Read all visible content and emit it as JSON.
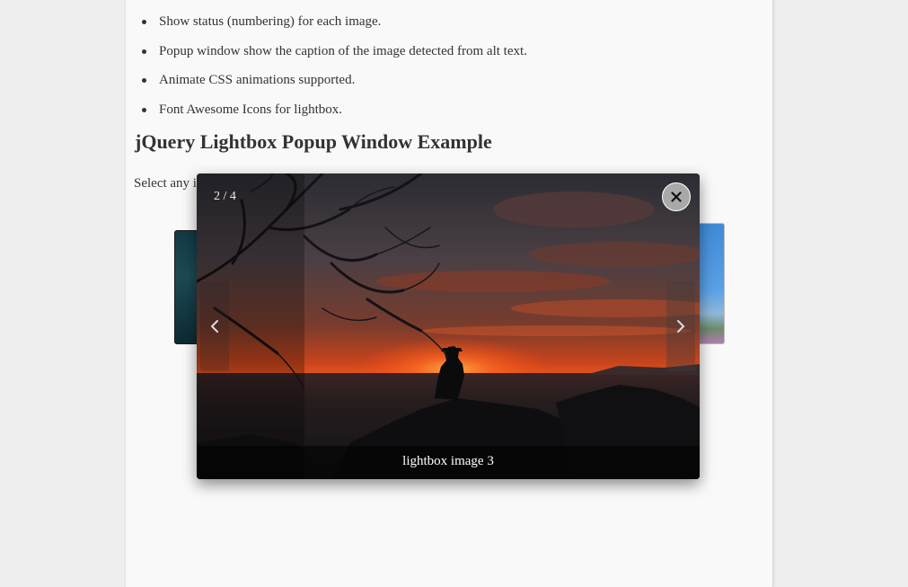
{
  "features": [
    "Show status (numbering) for each image.",
    "Popup window show the caption of the image detected from alt text.",
    "Animate CSS animations supported.",
    "Font Awesome Icons for lightbox."
  ],
  "heading": "jQuery Lightbox Popup Window Example",
  "intro_text": "Select any i",
  "lightbox": {
    "counter": "2 / 4",
    "caption": "lightbox image 3",
    "close_icon": "close-icon",
    "prev_icon": "chevron-left-icon",
    "next_icon": "chevron-right-icon"
  },
  "colors": {
    "page_bg": "#f9f9f9",
    "outer_bg": "#eeeeee",
    "text": "#333333",
    "sunset": "#e8461c"
  }
}
